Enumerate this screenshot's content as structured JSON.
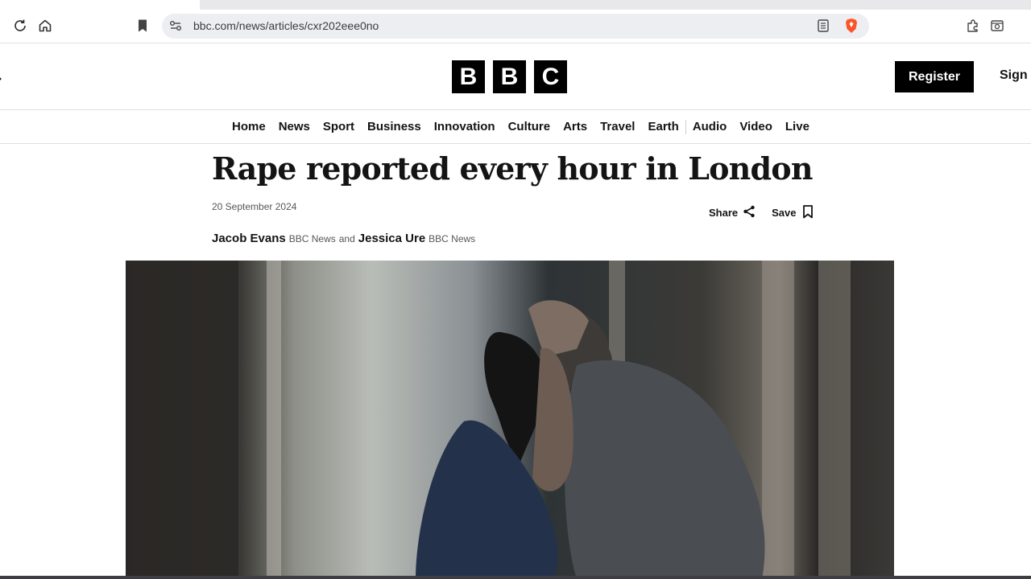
{
  "browser": {
    "url": "bbc.com/news/articles/cxr202eee0no",
    "icons": [
      "reload-icon",
      "home-icon",
      "bookmark-icon",
      "site-info-icon",
      "reader-mode-icon",
      "brave-shield-icon",
      "extensions-icon",
      "screenshot-icon"
    ]
  },
  "header": {
    "logo_letters": [
      "B",
      "B",
      "C"
    ],
    "register_label": "Register",
    "signin_label": "Sign"
  },
  "nav": {
    "items": [
      "Home",
      "News",
      "Sport",
      "Business",
      "Innovation",
      "Culture",
      "Arts",
      "Travel",
      "Earth",
      "Audio",
      "Video",
      "Live"
    ]
  },
  "article": {
    "headline": "Rape reported every hour in London",
    "date": "20 September 2024",
    "share_label": "Share",
    "save_label": "Save",
    "byline": {
      "author1": "Jacob Evans",
      "affil1": "BBC News",
      "conjunction": "and",
      "author2": "Jessica Ure",
      "affil2": "BBC News"
    }
  },
  "colors": {
    "brand_black": "#000000",
    "text": "#141414",
    "meta_text": "#545658",
    "brave_orange": "#fb542b"
  }
}
